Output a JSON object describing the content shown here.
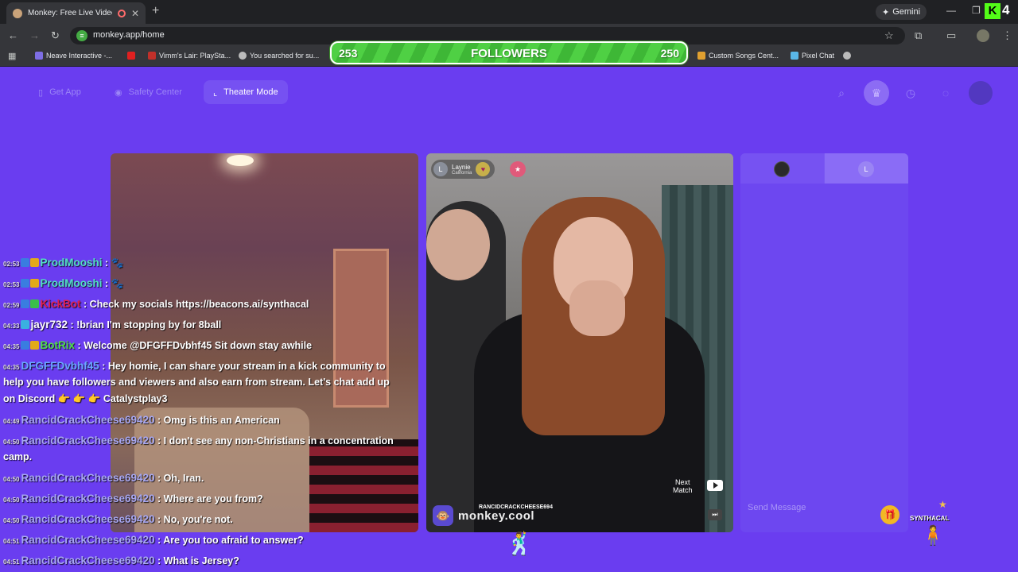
{
  "browser": {
    "tab_title": "Monkey: Free Live Video Ch",
    "new_tab": "+",
    "gemini": "Gemini",
    "url": "monkey.app/home",
    "bookmarks": [
      {
        "label": "Neave Interactive -...",
        "color": "#7e6ee4"
      },
      {
        "label": "Vimm's Lair: PlaySta...",
        "color": "#c0302a"
      },
      {
        "label": "You searched for su...",
        "color": "#bbbbbb"
      },
      {
        "label": "Custom Songs Cent...",
        "color": "#e0a030"
      },
      {
        "label": "Pixel Chat",
        "color": "#5ab7e8"
      }
    ]
  },
  "overlay": {
    "followers_label": "FOLLOWERS",
    "followers_current": "253",
    "followers_goal": "250",
    "kick_number": "4"
  },
  "app_nav": {
    "get_app": "Get App",
    "safety_center": "Safety Center",
    "theater_mode": "Theater Mode"
  },
  "peer": {
    "avatar_letter": "L",
    "name": "Laynie",
    "location": "California"
  },
  "video": {
    "next_match": "Next\nMatch",
    "watermark": "monkey.cool",
    "kick_username": "RANCIDCRACKCHEESE694"
  },
  "chat_panel": {
    "peer_letter": "L",
    "send_placeholder": "Send Message"
  },
  "kick_chat": [
    {
      "time": "02:53",
      "user": "ProdMooshi",
      "user_color": "#52e0c4",
      "badges": [
        "#3a7de0",
        "#e3a91a"
      ],
      "text": " : 🐾"
    },
    {
      "time": "02:53",
      "user": "ProdMooshi",
      "user_color": "#52e0c4",
      "badges": [
        "#3a7de0",
        "#e3a91a"
      ],
      "text": " : 🐾"
    },
    {
      "time": "02:59",
      "user": "KickBot",
      "user_color": "#e0204a",
      "badges": [
        "#3a7de0",
        "#3ac04a"
      ],
      "text": " : Check my socials https://beacons.ai/synthacal"
    },
    {
      "time": "04:33",
      "user": "jayr732",
      "user_color": "#ffffff",
      "badges": [
        "#3ab0e0"
      ],
      "text": " : !brian I'm stopping by for 8ball"
    },
    {
      "time": "04:35",
      "user": "BotRix",
      "user_color": "#52e04a",
      "badges": [
        "#3a7de0",
        "#e3a91a"
      ],
      "text": " : Welcome @DFGFFDvbhf45 Sit down stay awhile"
    },
    {
      "time": "04:35",
      "user": "DFGFFDvbhf45",
      "user_color": "#6aa6ff",
      "badges": [],
      "text": " : Hey homie, I can share your stream in a kick community to"
    },
    {
      "time": "",
      "user": "",
      "user_color": "#ffffff",
      "badges": [],
      "text": "help you have followers and viewers and also earn from stream. Let's chat add up"
    },
    {
      "time": "",
      "user": "",
      "user_color": "#ffffff",
      "badges": [],
      "text": "on Discord 👉 👉 👉 Catalystplay3"
    },
    {
      "time": "04:49",
      "user": "RancidCrackCheese69420",
      "user_color": "#a7a7f2",
      "badges": [],
      "text": " : Omg is this an American"
    },
    {
      "time": "04:50",
      "user": "RancidCrackCheese69420",
      "user_color": "#a7a7f2",
      "badges": [],
      "text": " : I don't see any non-Christians in a concentration"
    },
    {
      "time": "",
      "user": "",
      "user_color": "#ffffff",
      "badges": [],
      "text": "camp."
    },
    {
      "time": "04:50",
      "user": "RancidCrackCheese69420",
      "user_color": "#a7a7f2",
      "badges": [],
      "text": " : Oh, Iran."
    },
    {
      "time": "04:50",
      "user": "RancidCrackCheese69420",
      "user_color": "#a7a7f2",
      "badges": [],
      "text": " : Where are you from?"
    },
    {
      "time": "04:50",
      "user": "RancidCrackCheese69420",
      "user_color": "#a7a7f2",
      "badges": [],
      "text": " : No, you're not."
    },
    {
      "time": "04:51",
      "user": "RancidCrackCheese69420",
      "user_color": "#a7a7f2",
      "badges": [],
      "text": " : Are you too afraid to answer?"
    },
    {
      "time": "04:51",
      "user": "RancidCrackCheese69420",
      "user_color": "#a7a7f2",
      "badges": [],
      "text": " : What is Jersey?"
    }
  ],
  "sprites": {
    "synth_label": "SYNTHACAL"
  }
}
